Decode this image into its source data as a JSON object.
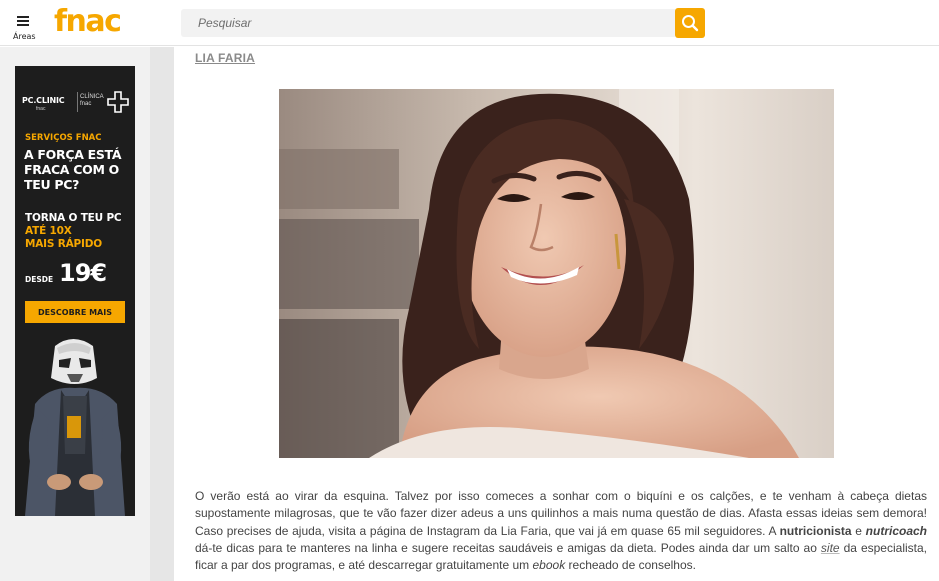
{
  "header": {
    "menu_label": "Áreas",
    "logo_text": "fnac",
    "search_placeholder": "Pesquisar",
    "search_icon": "search-icon",
    "accent_color": "#f6a700"
  },
  "ad": {
    "brand_left": "PC.CLINIC",
    "brand_left_sub": "fnac",
    "brand_right_line1": "CLÍNICA",
    "brand_right_line2": "fnac",
    "tag": "SERVIÇOS FNAC",
    "headline": "A FORÇA ESTÁ FRACA COM O TEU PC?",
    "body_line1": "TORNA O TEU PC",
    "body_line2": "ATÉ 10X",
    "body_line3": "MAIS RÁPIDO",
    "price_label": "DESDE",
    "price": "19€",
    "cta": "DESCOBRE MAIS"
  },
  "article": {
    "author": "LIA FARIA",
    "photo_alt": "Lia Faria",
    "p1_a": "O verão está ao virar da esquina. Talvez por isso comeces a sonhar com o biquíni e os calções, e te venham à cabeça dietas supostamente milagrosas, que te vão fazer dizer adeus a uns quilinhos a mais numa questão de dias. Afasta essas ideias sem demora! Caso precises de ajuda, visita a página de Instagram da Lia Faria, que vai já em quase 65 mil seguidores. A ",
    "p1_strong1": "nutricionista",
    "p1_and": " e ",
    "p1_strong2": "nutricoach",
    "p1_b": " dá-te dicas para te manteres na linha e sugere receitas saudáveis e amigas da dieta. Podes ainda dar um salto ao ",
    "p1_site": "site",
    "p1_c": " da especialista, ficar a par dos programas, e até descarregar gratuitamente um ",
    "p1_ebook": "ebook",
    "p1_d": " recheado de conselhos."
  }
}
